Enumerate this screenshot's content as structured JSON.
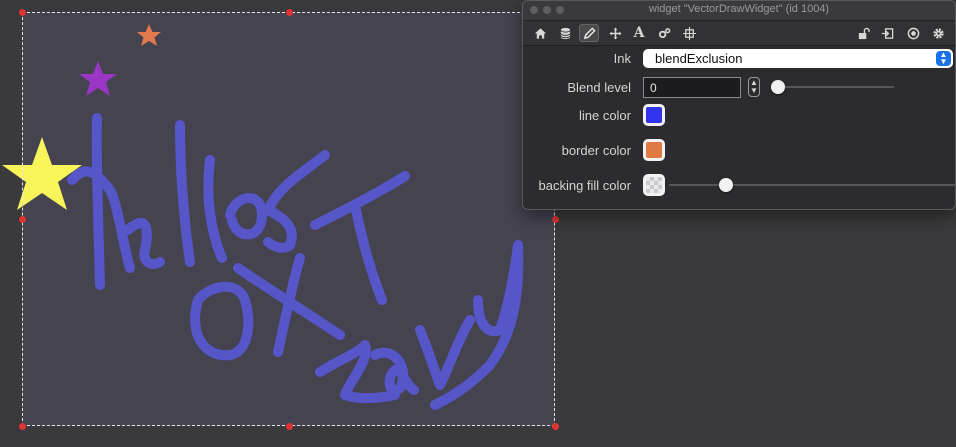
{
  "window": {
    "title": "widget \"VectorDrawWidget\" (id 1004)"
  },
  "toolbar": {
    "left_icons": [
      "home-icon",
      "database-icon",
      "pencil-icon",
      "move-icon",
      "text-icon",
      "gears-icon",
      "resize-icon"
    ],
    "right_icons": [
      "unlock-icon",
      "export-icon",
      "target-icon",
      "gear-icon"
    ],
    "active_tab": "pencil-icon"
  },
  "inspector": {
    "ink_label": "Ink",
    "ink_value": "blendExclusion",
    "blend_label": "Blend level",
    "blend_value": "0",
    "blend_slider_fraction": 0.0,
    "line_color_label": "line color",
    "line_color": "#3333ee",
    "border_color_label": "border color",
    "border_color": "#e07a45",
    "backing_fill_label": "backing fill color",
    "backing_fill_slider_fraction": 0.2
  },
  "drawing": {
    "stroke_color": "#5656c8",
    "star_colors": [
      "#f8f55a",
      "#9a36c4",
      "#e0794c"
    ],
    "canvas_color": "#454350"
  }
}
